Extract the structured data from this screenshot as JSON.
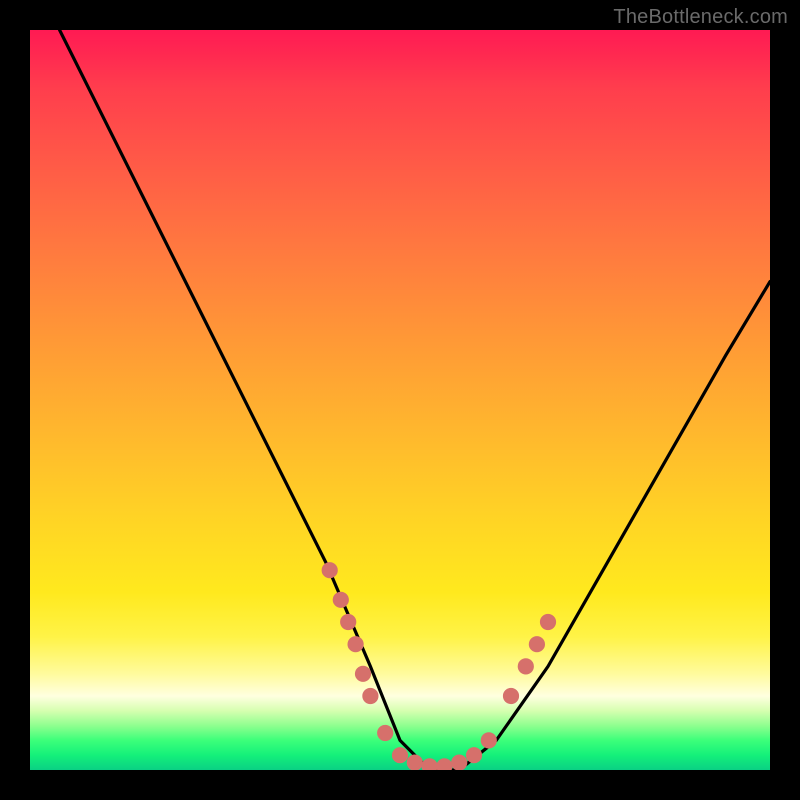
{
  "attribution": "TheBottleneck.com",
  "chart_data": {
    "type": "line",
    "title": "",
    "xlabel": "",
    "ylabel": "",
    "xlim": [
      0,
      100
    ],
    "ylim": [
      0,
      100
    ],
    "background_gradient": [
      "#ff1a53",
      "#ff7a3f",
      "#ffd624",
      "#ffffe0",
      "#14f07a"
    ],
    "series": [
      {
        "name": "bottleneck-curve",
        "color": "#000000",
        "x": [
          4,
          10,
          16,
          22,
          28,
          34,
          40,
          46,
          50,
          54,
          58,
          63,
          70,
          78,
          86,
          94,
          100
        ],
        "y": [
          100,
          88,
          76,
          64,
          52,
          40,
          28,
          14,
          4,
          0,
          0,
          4,
          14,
          28,
          42,
          56,
          66
        ]
      }
    ],
    "markers": {
      "name": "dotted-cluster",
      "color": "#d6706b",
      "radius_pct": 1.1,
      "points": [
        {
          "x": 40.5,
          "y": 27
        },
        {
          "x": 42,
          "y": 23
        },
        {
          "x": 43,
          "y": 20
        },
        {
          "x": 44,
          "y": 17
        },
        {
          "x": 45,
          "y": 13
        },
        {
          "x": 46,
          "y": 10
        },
        {
          "x": 48,
          "y": 5
        },
        {
          "x": 50,
          "y": 2
        },
        {
          "x": 52,
          "y": 1
        },
        {
          "x": 54,
          "y": 0.5
        },
        {
          "x": 56,
          "y": 0.5
        },
        {
          "x": 58,
          "y": 1
        },
        {
          "x": 60,
          "y": 2
        },
        {
          "x": 62,
          "y": 4
        },
        {
          "x": 65,
          "y": 10
        },
        {
          "x": 67,
          "y": 14
        },
        {
          "x": 68.5,
          "y": 17
        },
        {
          "x": 70,
          "y": 20
        }
      ]
    }
  }
}
